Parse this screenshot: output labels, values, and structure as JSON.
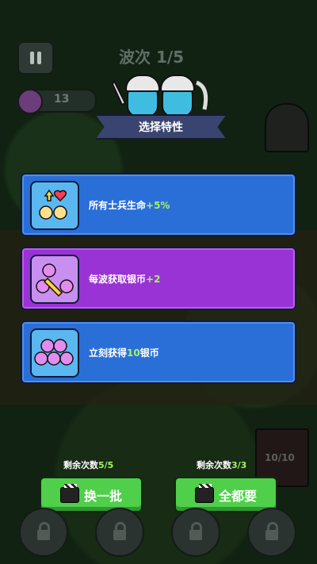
{
  "hud": {
    "wave": "波次 1/5",
    "coins": "13"
  },
  "banner": {
    "title": "选择特性"
  },
  "cards": [
    {
      "text": "所有士兵生命",
      "value": "+5%",
      "style": "blue",
      "icon": "soldiers-heart-icon"
    },
    {
      "text": "每波获取银币",
      "value": "+2",
      "style": "purple",
      "icon": "coin-sword-icon"
    },
    {
      "text_pre": "立刻获得",
      "value": "10",
      "text_post": "银币",
      "style": "blue",
      "icon": "coin-pile-icon"
    }
  ],
  "reroll": {
    "label": "剩余次数",
    "count": "5/5",
    "button": "换一批"
  },
  "takeall": {
    "label": "剩余次数",
    "count": "3/3",
    "button": "全都要"
  },
  "castle": {
    "hp": "10/10"
  },
  "colors": {
    "blue_card": "#2a6fd8",
    "purple_card": "#9a33d6",
    "green_button": "#4fcf4a",
    "highlight": "#a8f06a"
  }
}
